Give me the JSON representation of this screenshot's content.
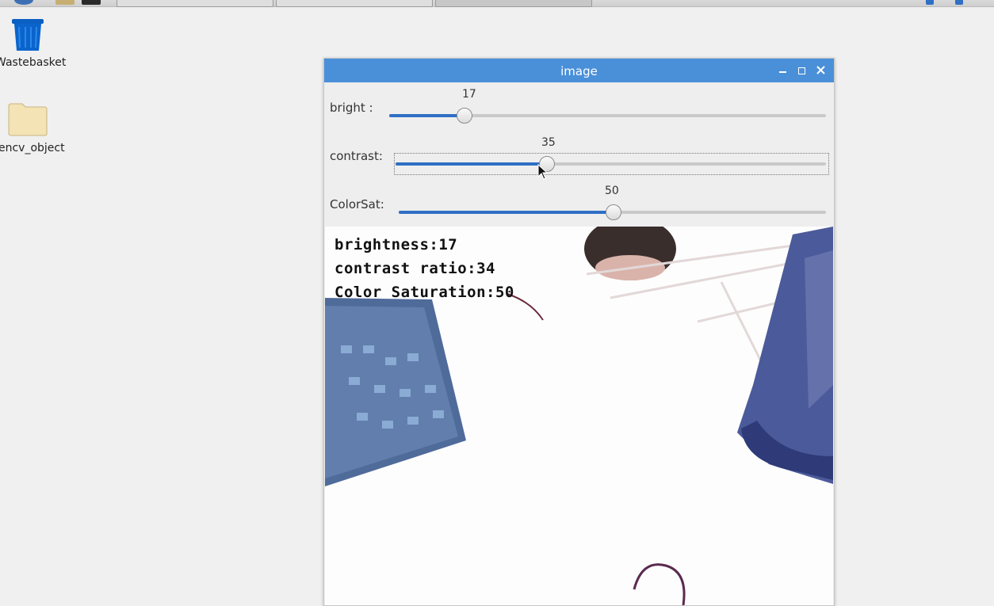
{
  "desktop": {
    "icons": [
      {
        "label": "Wastebasket",
        "name": "wastebasket-icon"
      },
      {
        "label": "encv_object",
        "name": "folder-icon"
      }
    ]
  },
  "window": {
    "title": "image",
    "controls": {
      "minimize": "‗",
      "maximize": "□",
      "close": "✕"
    }
  },
  "trackbars": [
    {
      "label": "bright :",
      "value": "17",
      "fraction": 0.17
    },
    {
      "label": "contrast:",
      "value": "35",
      "fraction": 0.35
    },
    {
      "label": "ColorSat:",
      "value": "50",
      "fraction": 0.5
    }
  ],
  "overlay": {
    "line1": "brightness:17",
    "line2": "contrast ratio:34",
    "line3": "Color Saturation:50"
  },
  "colors": {
    "titlebar": "#4a90d9",
    "slider_fill": "#2f6fc4"
  }
}
